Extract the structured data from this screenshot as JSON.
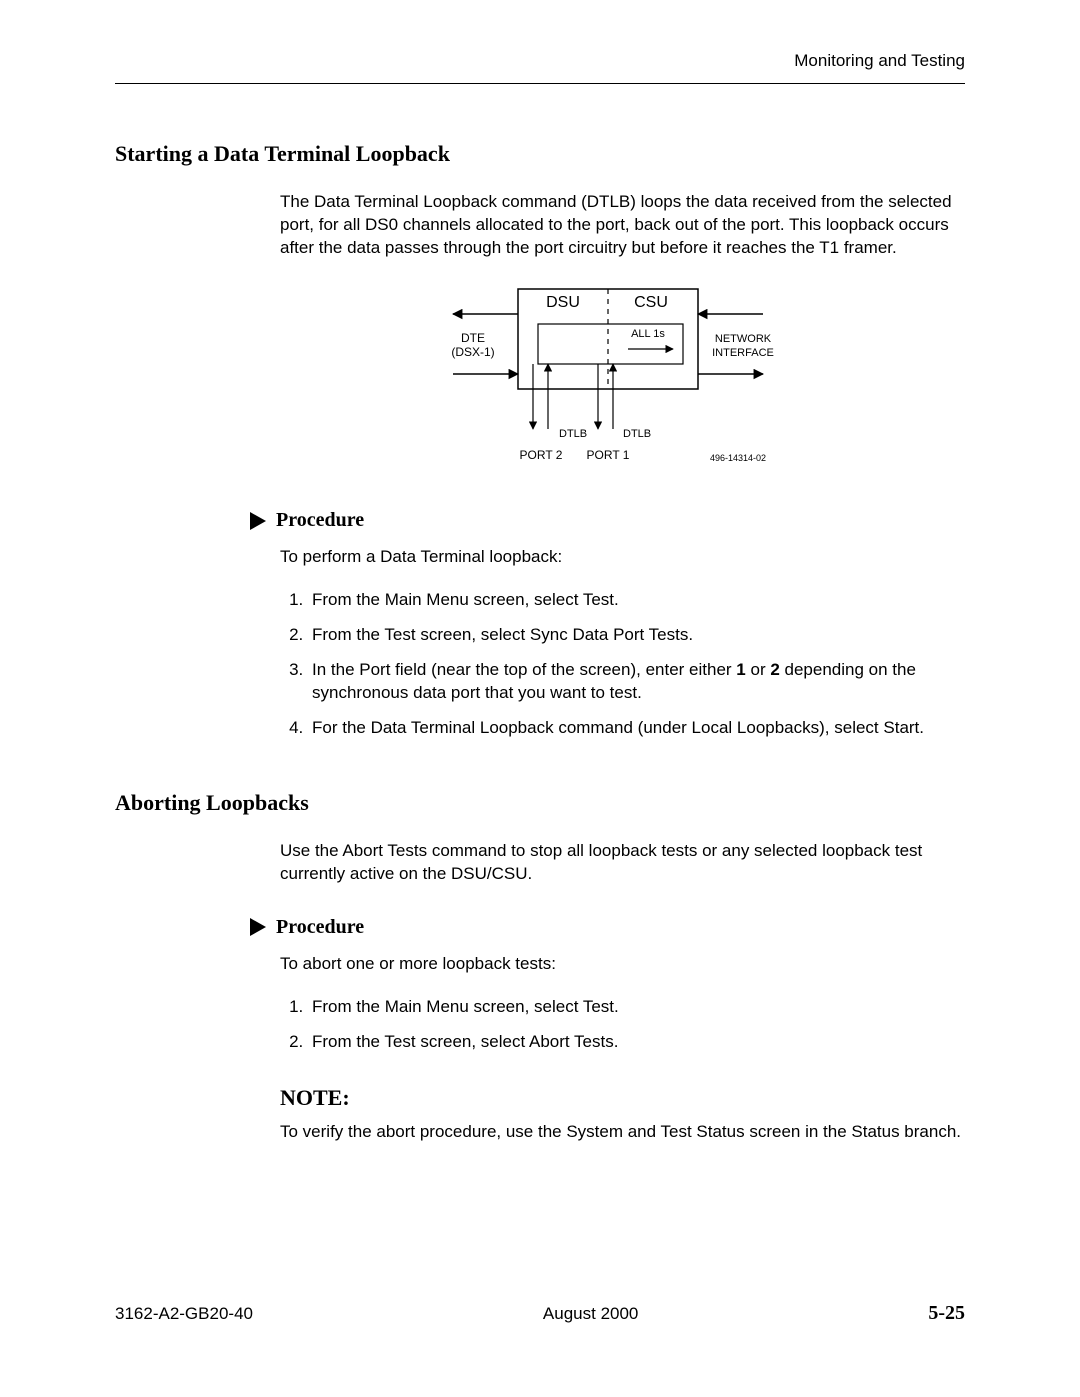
{
  "header": {
    "section": "Monitoring and Testing"
  },
  "section1": {
    "title": "Starting a Data Terminal Loopback",
    "intro": "The Data Terminal Loopback command (DTLB) loops the data received from the selected port, for all DS0 channels allocated to the port, back out of the port. This loopback occurs after the data passes through the port circuitry but before it reaches the T1 framer.",
    "procedure_label": "Procedure",
    "procedure_intro": "To perform a Data Terminal loopback:",
    "steps": {
      "s1": "From the Main Menu screen, select Test.",
      "s2": "From the Test screen, select Sync Data Port Tests.",
      "s3a": "In the Port field (near the top of the screen), enter either ",
      "s3b1": "1",
      "s3b": " or ",
      "s3b2": "2",
      "s3c": " depending on the synchronous data port that you want to test.",
      "s4": "For the Data Terminal Loopback command (under Local Loopbacks), select Start."
    }
  },
  "diagram": {
    "dsu": "DSU",
    "csu": "CSU",
    "dte1": "DTE",
    "dte2": "(DSX-1)",
    "all1s": "ALL 1s",
    "net1": "NETWORK",
    "net2": "INTERFACE",
    "dtlb": "DTLB",
    "port2": "PORT 2",
    "port1": "PORT 1",
    "figno": "496-14314-02"
  },
  "section2": {
    "title": "Aborting Loopbacks",
    "intro": "Use the Abort Tests command to stop all loopback tests or any selected loopback test currently active on the DSU/CSU.",
    "procedure_label": "Procedure",
    "procedure_intro": "To abort one or more loopback tests:",
    "steps": {
      "s1": "From the Main Menu screen, select Test.",
      "s2": "From the Test screen, select Abort Tests."
    },
    "note_label": "NOTE:",
    "note_text": "To verify the abort procedure, use the System and Test Status screen in the Status branch."
  },
  "footer": {
    "doc": "3162-A2-GB20-40",
    "date": "August 2000",
    "page": "5-25"
  }
}
